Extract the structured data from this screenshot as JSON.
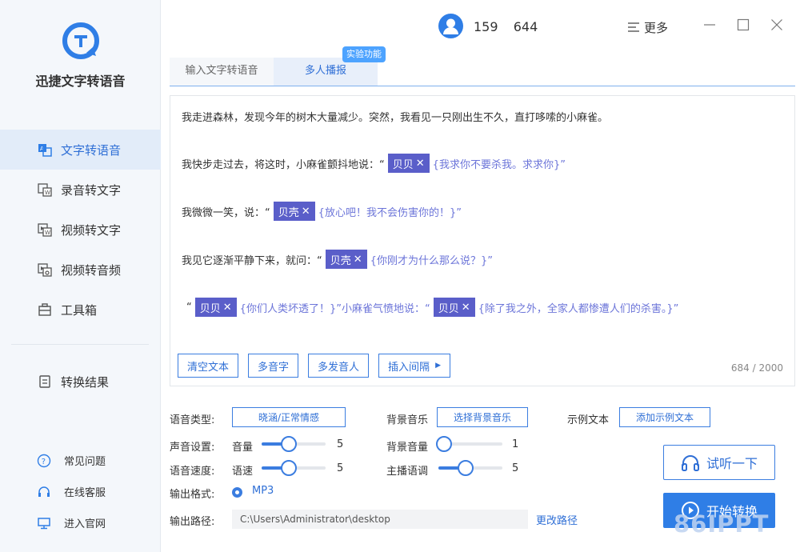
{
  "app": {
    "name": "迅捷文字转语音",
    "accent": "#2f7ee6",
    "sidebar_bg": "#f4f7fb"
  },
  "sidebar": {
    "items": [
      {
        "label": "文字转语音",
        "icon": "text-to-speech-icon",
        "active": true
      },
      {
        "label": "录音转文字",
        "icon": "recording-to-text-icon",
        "active": false
      },
      {
        "label": "视频转文字",
        "icon": "video-to-text-icon",
        "active": false
      },
      {
        "label": "视频转音频",
        "icon": "video-to-audio-icon",
        "active": false
      },
      {
        "label": "工具箱",
        "icon": "toolbox-icon",
        "active": false
      }
    ],
    "result": {
      "label": "转换结果",
      "icon": "results-icon"
    },
    "links": [
      {
        "label": "常见问题",
        "icon": "question-icon"
      },
      {
        "label": "在线客服",
        "icon": "headset-icon"
      },
      {
        "label": "进入官网",
        "icon": "monitor-icon"
      }
    ]
  },
  "header": {
    "user": "159      644",
    "more_label": "更多",
    "window_controls": [
      "minimize-icon",
      "maximize-icon",
      "close-icon"
    ]
  },
  "tabs": [
    {
      "label": "输入文字转语音",
      "active": false
    },
    {
      "label": "多人播报",
      "active": true
    }
  ],
  "exp_badge": "实验功能",
  "editor": {
    "line1": "我走进森林，发现今年的树木大量减少。突然，我看见一只刚出生不久，直打哆嗦的小麻雀。",
    "line2_pre": "我快步走过去，将这时，小麻雀颤抖地说：“",
    "line2_chip": "贝贝",
    "line2_post": "{我求你不要杀我。求求你}”",
    "line3_pre": "我微微一笑，说：“",
    "line3_chip": "贝壳",
    "line3_post": "{放心吧！我不会伤害你的！}”",
    "line4_pre": "我见它逐渐平静下来，就问：“",
    "line4_chip": "贝壳",
    "line4_post": "{你刚才为什么那么说？}”",
    "line5_pre": "“",
    "line5_chip1": "贝贝",
    "line5_mid": "{你们人类坏透了！}”小麻雀气愤地说：“",
    "line5_chip2": "贝贝",
    "line5_post": "{除了我之外，全家人都惨遭人们的杀害。}”",
    "chip_close": "✕",
    "buttons": [
      "清空文本",
      "多音字",
      "多发音人",
      "插入间隔"
    ],
    "counter": "684 / 2000"
  },
  "settings": {
    "voice_type_label": "语音类型:",
    "voice_type_value": "晓涵/正常情感",
    "bgm_label": "背景音乐",
    "bgm_button": "选择背景音乐",
    "sample_label": "示例文本",
    "sample_button": "添加示例文本",
    "sound_label": "声音设置:",
    "volume_label": "音量",
    "volume_value": "5",
    "bgm_volume_label": "背景音量",
    "bgm_volume_value": "1",
    "speed_label": "语音速度:",
    "speed_sub_label": "语速",
    "speed_value": "5",
    "pitch_label": "主播语调",
    "pitch_value": "5",
    "format_label": "输出格式:",
    "format_value": "MP3",
    "path_label": "输出路径:",
    "path_value": "C:\\Users\\Administrator\\desktop",
    "change_path": "更改路径"
  },
  "actions": {
    "preview": "试听一下",
    "start": "开始转换"
  },
  "watermark": "86IPPT"
}
